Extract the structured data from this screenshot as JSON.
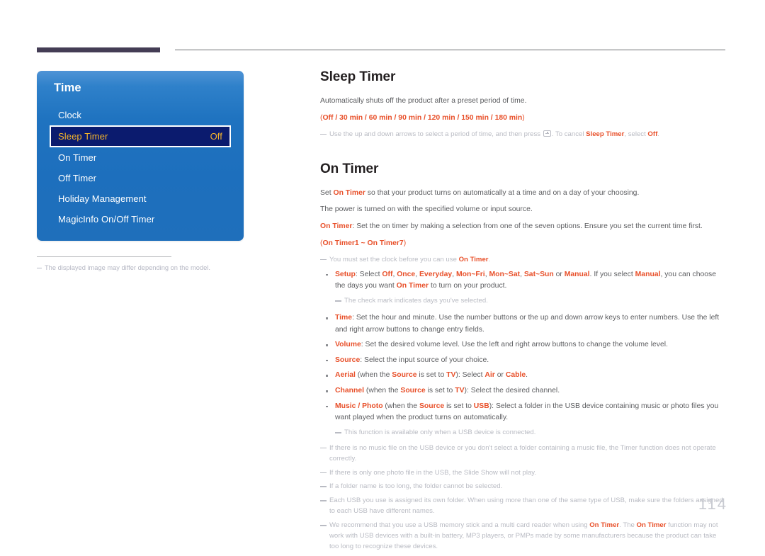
{
  "header": {
    "rule_color": "#443d55"
  },
  "osd": {
    "title": "Time",
    "items": [
      {
        "label": "Clock",
        "value": "",
        "selected": false
      },
      {
        "label": "Sleep Timer",
        "value": "Off",
        "selected": true
      },
      {
        "label": "On Timer",
        "value": "",
        "selected": false
      },
      {
        "label": "Off Timer",
        "value": "",
        "selected": false
      },
      {
        "label": "Holiday Management",
        "value": "",
        "selected": false
      },
      {
        "label": "MagicInfo On/Off Timer",
        "value": "",
        "selected": false
      }
    ],
    "caption": "The displayed image may differ depending on the model."
  },
  "sections": {
    "sleep_timer": {
      "heading": "Sleep Timer",
      "para1": "Automatically shuts off the product after a preset period of time.",
      "options_open": "(",
      "options": "Off / 30 min / 60 min / 90 min / 120 min / 150 min / 180 min",
      "options_close": ")",
      "note_a": "Use the up and down arrows to select a period of time, and then press ",
      "note_b": ". To cancel ",
      "note_c": "Sleep Timer",
      "note_d": ", select ",
      "note_e": "Off",
      "note_f": "."
    },
    "on_timer": {
      "heading": "On Timer",
      "para1_a": "Set ",
      "para1_b": "On Timer",
      "para1_c": " so that your product turns on automatically at a time and on a day of your choosing.",
      "para2": "The power is turned on with the specified volume or input source.",
      "para3_a": "On Timer",
      "para3_b": ": Set the on timer by making a selection from one of the seven options. Ensure you set the current time first.",
      "range": "(On Timer1 ~ On Timer7)",
      "range_bold": "On Timer1 ~ On Timer7",
      "note_clock_a": "You must set the clock before you can use ",
      "note_clock_b": "On Timer",
      "note_clock_c": ".",
      "bullets": [
        {
          "term": "Setup",
          "text": ": Select Off, Once, Everyday, Mon~Fri, Mon~Sat, Sat~Sun or Manual. If you select Manual, you can choose the days you want On Timer to turn on your product.",
          "subnote": "The check mark indicates days you've selected."
        },
        {
          "term": "Time",
          "text": ": Set the hour and minute. Use the number buttons or the up and down arrow keys to enter numbers. Use the left and right arrow buttons to change entry fields."
        },
        {
          "term": "Volume",
          "text": ": Set the desired volume level. Use the left and right arrow buttons to change the volume level."
        },
        {
          "term": "Source",
          "text": ": Select the input source of your choice."
        },
        {
          "term": "Aerial",
          "text": " (when the Source is set to TV): Select Air or Cable."
        },
        {
          "term": "Channel",
          "text": " (when the Source is set to TV): Select the desired channel."
        },
        {
          "term": "Music / Photo",
          "text": " (when the Source is set to USB): Select a folder in the USB device containing music or photo files you want played when the product turns on automatically.",
          "subnote": "This function is available only when a USB device is connected."
        }
      ],
      "notes": [
        "If there is no music file on the USB device or you don't select a folder containing a music file, the Timer function does not operate correctly.",
        "If there is only one photo file in the USB, the Slide Show will not play.",
        "If a folder name is too long, the folder cannot be selected.",
        "Each USB you use is assigned its own folder. When using more than one of the same type of USB, make sure the folders assigned to each USB have different names.",
        "We recommend that you use a USB memory stick and a multi card reader when using On Timer. The On Timer function may not work with USB devices with a built-in battery, MP3 players, or PMPs made by some manufacturers because the product can take too long to recognize these devices."
      ]
    }
  },
  "page_number": "114",
  "colors": {
    "accent": "#e8502a",
    "osd_blue": "#1f73c0",
    "osd_selected_bg": "#0b1b6e",
    "osd_selected_text": "#f5b52a",
    "note_gray": "#b9bbc3",
    "header_bar": "#443d55"
  }
}
